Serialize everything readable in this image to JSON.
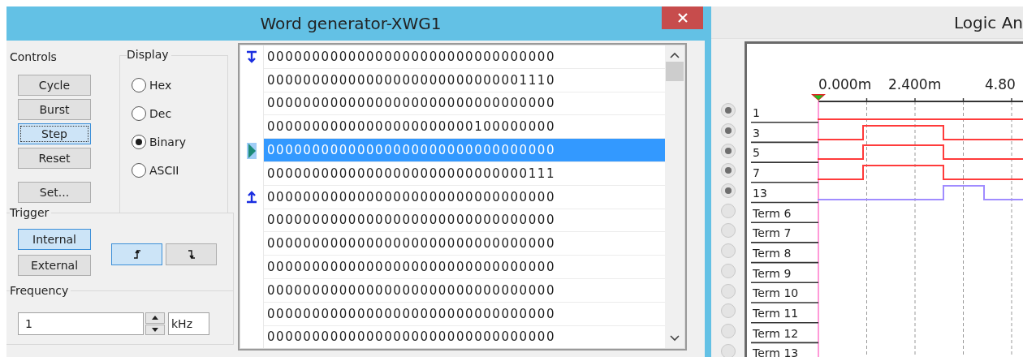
{
  "word_generator": {
    "title": "Word generator-XWG1",
    "controls": {
      "label": "Controls",
      "buttons": [
        {
          "label": "Cycle",
          "focused": false
        },
        {
          "label": "Burst",
          "focused": false
        },
        {
          "label": "Step",
          "focused": true
        },
        {
          "label": "Reset",
          "focused": false
        },
        {
          "label": "Set...",
          "focused": false
        }
      ]
    },
    "display": {
      "label": "Display",
      "options": [
        {
          "label": "Hex",
          "selected": false
        },
        {
          "label": "Dec",
          "selected": false
        },
        {
          "label": "Binary",
          "selected": true
        },
        {
          "label": "ASCII",
          "selected": false
        }
      ]
    },
    "trigger": {
      "label": "Trigger",
      "sources": [
        {
          "label": "Internal",
          "selected": true
        },
        {
          "label": "External",
          "selected": false
        }
      ],
      "edges": [
        {
          "kind": "rising",
          "selected": true
        },
        {
          "kind": "falling",
          "selected": false
        }
      ]
    },
    "frequency": {
      "label": "Frequency",
      "value": "1",
      "unit": "kHz"
    },
    "words": [
      {
        "value": "00000000000000000000000000000000",
        "kind": "initial",
        "selected": false
      },
      {
        "value": "00000000000000000000000000001110",
        "selected": false
      },
      {
        "value": "00000000000000000000000000000000",
        "selected": false
      },
      {
        "value": "00000000000000000000000100000000",
        "selected": false
      },
      {
        "value": "00000000000000000000000000000000",
        "kind": "current",
        "selected": true
      },
      {
        "value": "00000000000000000000000000000111",
        "selected": false
      },
      {
        "value": "00000000000000000000000000000000",
        "kind": "final",
        "selected": false
      },
      {
        "value": "00000000000000000000000000000000",
        "selected": false
      },
      {
        "value": "00000000000000000000000000000000",
        "selected": false
      },
      {
        "value": "00000000000000000000000000000000",
        "selected": false
      },
      {
        "value": "00000000000000000000000000000000",
        "selected": false
      },
      {
        "value": "00000000000000000000000000000000",
        "selected": false
      },
      {
        "value": "00000000000000000000000000000000",
        "selected": false
      }
    ]
  },
  "logic_analyzer": {
    "title": "Logic An",
    "time_labels": [
      "0.000m",
      "2.400m",
      "4.80"
    ],
    "channels": [
      {
        "label": "1",
        "connected": true,
        "high_steps": [
          false,
          false,
          false,
          false,
          false
        ],
        "color": "#ff3b3b"
      },
      {
        "label": "3",
        "connected": true,
        "high_steps": [
          false,
          true,
          true,
          false,
          false
        ],
        "color": "#ff3b3b"
      },
      {
        "label": "5",
        "connected": true,
        "high_steps": [
          false,
          true,
          true,
          false,
          false
        ],
        "color": "#ff3b3b"
      },
      {
        "label": "7",
        "connected": true,
        "high_steps": [
          false,
          true,
          true,
          false,
          false
        ],
        "color": "#ff3b3b"
      },
      {
        "label": "13",
        "connected": true,
        "high_steps": [
          false,
          false,
          false,
          true,
          false
        ],
        "color": "#a08cff"
      },
      {
        "label": "Term 6",
        "connected": false
      },
      {
        "label": "Term 7",
        "connected": false
      },
      {
        "label": "Term 8",
        "connected": false
      },
      {
        "label": "Term 9",
        "connected": false
      },
      {
        "label": "Term 10",
        "connected": false
      },
      {
        "label": "Term 11",
        "connected": false
      },
      {
        "label": "Term 12",
        "connected": false
      },
      {
        "label": "Term 13",
        "connected": false
      }
    ]
  }
}
